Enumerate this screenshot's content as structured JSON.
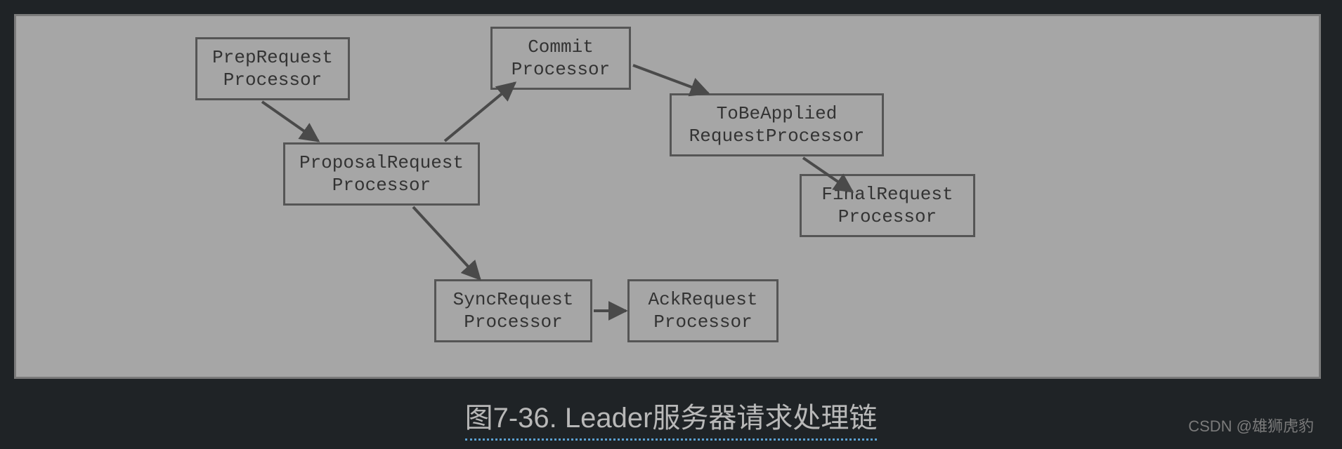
{
  "caption": "图7-36. Leader服务器请求处理链",
  "watermark": "CSDN @雄狮虎豹",
  "nodes": {
    "prep": {
      "l1": "PrepRequest",
      "l2": "Processor"
    },
    "proposal": {
      "l1": "ProposalRequest",
      "l2": "Processor"
    },
    "commit": {
      "l1": "Commit",
      "l2": "Processor"
    },
    "sync": {
      "l1": "SyncRequest",
      "l2": "Processor"
    },
    "ack": {
      "l1": "AckRequest",
      "l2": "Processor"
    },
    "toapply": {
      "l1": "ToBeApplied",
      "l2": "RequestProcessor"
    },
    "final": {
      "l1": "FinalRequest",
      "l2": "Processor"
    }
  },
  "arrow_color": "#4a4a4a"
}
